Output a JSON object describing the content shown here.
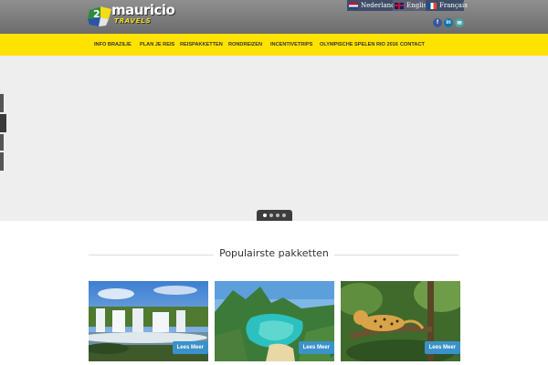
{
  "header": {
    "logo": {
      "name": "mauricio",
      "tagline": "TRAVELS"
    },
    "languages": [
      {
        "label": "Nederlands",
        "code": "nl"
      },
      {
        "label": "English",
        "code": "en"
      },
      {
        "label": "Français",
        "code": "fr"
      }
    ],
    "social": [
      {
        "icon": "facebook-icon",
        "glyph": "f"
      },
      {
        "icon": "linkedin-icon",
        "glyph": "in"
      },
      {
        "icon": "mail-icon",
        "glyph": "✉"
      }
    ]
  },
  "nav": {
    "items": [
      "INFO BRAZILIE",
      "PLAN JE REIS",
      "REISPAKKETTEN",
      "RONDREIZEN",
      "INCENTIVETRIPS",
      "OLYMPISCHE SPELEN RIO 2016",
      "CONTACT"
    ]
  },
  "slider": {
    "slide_count": 4,
    "active_slide": 1
  },
  "section": {
    "title": "Populairste pakketten"
  },
  "cards": [
    {
      "image": "waterfall-photo",
      "button": "Lees Meer"
    },
    {
      "image": "tropical-bay-photo",
      "button": "Lees Meer"
    },
    {
      "image": "jaguar-photo",
      "button": "Lees Meer"
    }
  ],
  "colors": {
    "nav_yellow": "#fee200",
    "header_grey": "#7d7d7d",
    "button_blue": "#3a92c9"
  }
}
